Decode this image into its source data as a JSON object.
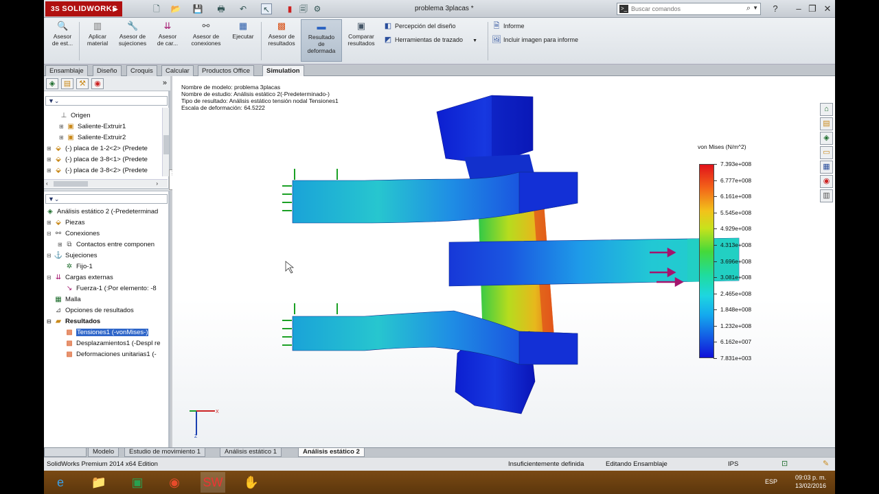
{
  "titlebar": {
    "logo": "SOLIDWORKS",
    "logo_ds": "3S",
    "doc_title": "problema 3placas *",
    "search_placeholder": "Buscar comandos"
  },
  "ribbon": {
    "buttons": [
      {
        "label": "Asesor\nde est...",
        "icon": "study-advisor-icon"
      },
      {
        "label": "Aplicar\nmaterial",
        "icon": "apply-material-icon"
      },
      {
        "label": "Asesor de\nsujeciones",
        "icon": "fixtures-advisor-icon"
      },
      {
        "label": "Asesor\nde car...",
        "icon": "loads-advisor-icon"
      },
      {
        "label": "Asesor de\nconexiones",
        "icon": "connections-advisor-icon"
      },
      {
        "label": "Ejecutar",
        "icon": "run-icon"
      },
      {
        "label": "Asesor de\nresultados",
        "icon": "results-advisor-icon"
      },
      {
        "label": "Resultado\nde\ndeformada",
        "icon": "deformed-result-icon"
      },
      {
        "label": "Comparar\nresultados",
        "icon": "compare-results-icon"
      }
    ],
    "rows": [
      "Percepción del diseño",
      "Herramientas de trazado",
      "Informe",
      "Incluir imagen para informe"
    ]
  },
  "command_tabs": [
    "Ensamblaje",
    "Diseño",
    "Croquis",
    "Calcular",
    "Productos Office",
    "Simulation"
  ],
  "active_command_tab": "Simulation",
  "tree_top": [
    {
      "label": "Origen",
      "indent": 2
    },
    {
      "label": "Saliente-Extruir1",
      "indent": 2
    },
    {
      "label": "Saliente-Extruir2",
      "indent": 2
    },
    {
      "label": "(-) placa de 1-2<2> (Predete",
      "indent": 0
    },
    {
      "label": "(-) placa de 3-8<1> (Predete",
      "indent": 0
    },
    {
      "label": "(-) placa de 3-8<2> (Predete",
      "indent": 0
    }
  ],
  "tree_study": {
    "root": "Análisis estático 2 (-Predeterminad",
    "items": [
      {
        "label": "Piezas",
        "indent": 1
      },
      {
        "label": "Conexiones",
        "indent": 1
      },
      {
        "label": "Contactos entre componen",
        "indent": 2
      },
      {
        "label": "Sujeciones",
        "indent": 1
      },
      {
        "label": "Fijo-1",
        "indent": 2
      },
      {
        "label": "Cargas externas",
        "indent": 1
      },
      {
        "label": "Fuerza-1 (:Por elemento: -8",
        "indent": 2
      },
      {
        "label": "Malla",
        "indent": 1
      },
      {
        "label": "Opciones de resultados",
        "indent": 1
      },
      {
        "label": "Resultados",
        "indent": 1,
        "bold": true
      },
      {
        "label": "Tensiones1 (-vonMises-)",
        "indent": 2,
        "selected": true
      },
      {
        "label": "Desplazamientos1 (-Despl re",
        "indent": 2
      },
      {
        "label": "Deformaciones unitarias1 (-",
        "indent": 2
      }
    ]
  },
  "plot_info": {
    "line1": "Nombre de modelo: problema 3placas",
    "line2": "Nombre de estudio: Análisis estático 2(-Predeterminado-)",
    "line3": "Tipo de resultado: Análisis estático tensión nodal Tensiones1",
    "line4": "Escala de deformación: 64.5222"
  },
  "legend": {
    "title": "von Mises (N/m^2)",
    "values": [
      "7.393e+008",
      "6.777e+008",
      "6.161e+008",
      "5.545e+008",
      "4.929e+008",
      "4.313e+008",
      "3.696e+008",
      "3.081e+008",
      "2.465e+008",
      "1.848e+008",
      "1.232e+008",
      "6.162e+007",
      "7.831e+003"
    ],
    "max_color": "#e1121a",
    "min_color": "#1111d8"
  },
  "bottom_tabs": [
    "Modelo",
    "Estudio de movimiento 1",
    "Análisis estático 1",
    "Análisis estático 2"
  ],
  "active_bottom_tab": "Análisis estático 2",
  "status": {
    "edition": "SolidWorks Premium 2014 x64 Edition",
    "definition": "Insuficientemente definida",
    "mode": "Editando Ensamblaje",
    "units": "IPS"
  },
  "taskbar": {
    "lang": "ESP",
    "time": "09:03 p. m.",
    "date": "13/02/2016"
  }
}
